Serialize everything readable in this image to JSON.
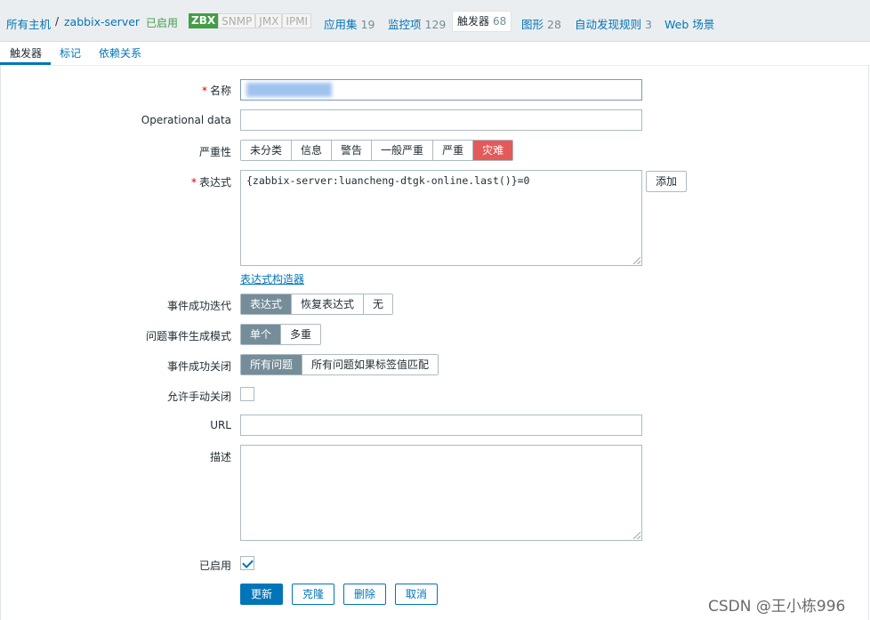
{
  "breadcrumb": {
    "all_hosts": "所有主机",
    "separator": "/",
    "host": "zabbix-server",
    "status": "已启用"
  },
  "availability": [
    "ZBX",
    "SNMP",
    "JMX",
    "IPMI"
  ],
  "host_nav": [
    {
      "label": "应用集",
      "count": "19"
    },
    {
      "label": "监控项",
      "count": "129"
    },
    {
      "label": "触发器",
      "count": "68"
    },
    {
      "label": "图形",
      "count": "28"
    },
    {
      "label": "自动发现规则",
      "count": "3"
    },
    {
      "label": "Web 场景",
      "count": ""
    }
  ],
  "tabs": [
    "触发器",
    "标记",
    "依赖关系"
  ],
  "form": {
    "name_label": "名称",
    "name_value": "",
    "opdata_label": "Operational data",
    "severity_label": "严重性",
    "severity_options": [
      "未分类",
      "信息",
      "警告",
      "一般严重",
      "严重",
      "灾难"
    ],
    "severity_selected": "灾难",
    "expression_label": "表达式",
    "expression_value": "{zabbix-server:luancheng-dtgk-online.last()}=0",
    "add_button": "添加",
    "expression_builder": "表达式构造器",
    "ok_event_label": "事件成功迭代",
    "ok_event_options": [
      "表达式",
      "恢复表达式",
      "无"
    ],
    "problem_mode_label": "问题事件生成模式",
    "problem_mode_options": [
      "单个",
      "多重"
    ],
    "ok_close_label": "事件成功关闭",
    "ok_close_options": [
      "所有问题",
      "所有问题如果标签值匹配"
    ],
    "manual_close_label": "允许手动关闭",
    "url_label": "URL",
    "description_label": "描述",
    "enabled_label": "已启用",
    "buttons": {
      "update": "更新",
      "clone": "克隆",
      "delete": "删除",
      "cancel": "取消"
    }
  },
  "watermark": "CSDN @王小栋996",
  "colors": {
    "accent": "#0275b8",
    "disaster": "#e45959",
    "enabled_green": "#429e47",
    "selected_gray": "#768d99"
  }
}
